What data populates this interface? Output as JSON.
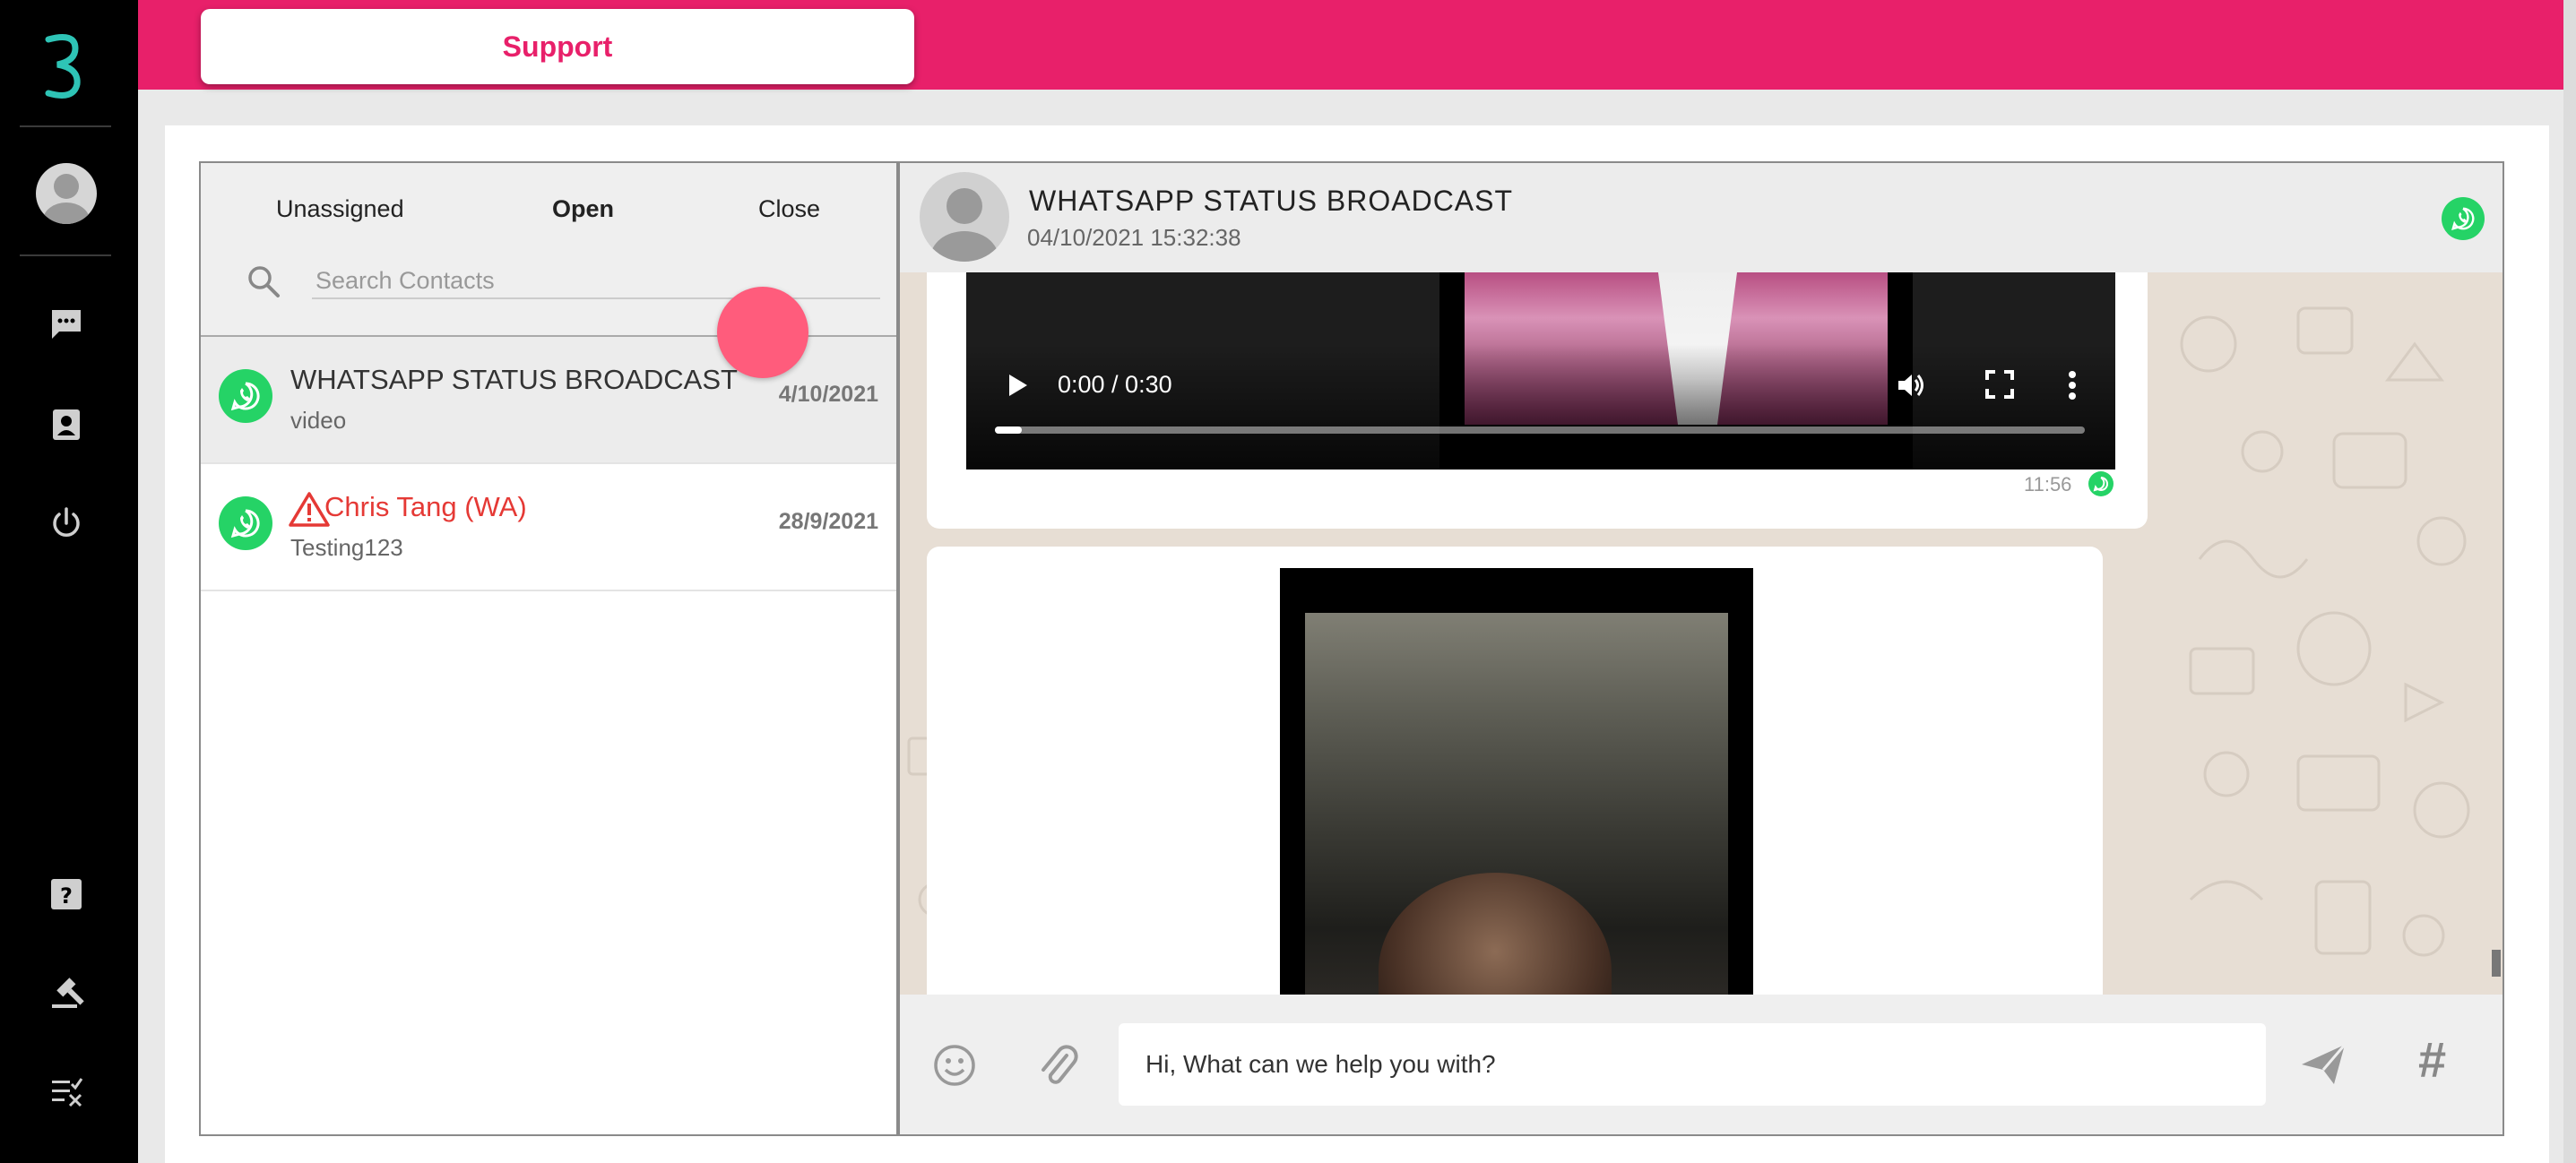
{
  "header": {
    "support_label": "Support"
  },
  "tabs": {
    "unassigned": "Unassigned",
    "open": "Open",
    "close": "Close"
  },
  "search": {
    "placeholder": "Search Contacts"
  },
  "contacts": [
    {
      "name": "WHATSAPP STATUS BROADCAST",
      "preview": "video",
      "date": "4/10/2021",
      "channel_icon": "whatsapp-icon"
    },
    {
      "name": "Chris Tang (WA)",
      "preview": "Testing123",
      "date": "28/9/2021",
      "channel_icon": "whatsapp-icon",
      "status_icon": "warning-icon"
    }
  ],
  "chat": {
    "title": "WHATSAPP STATUS BROADCAST",
    "timestamp": "04/10/2021 15:32:38",
    "messages": [
      {
        "type": "video",
        "time_display": "0:00 / 0:30",
        "sent_time": "11:56"
      },
      {
        "type": "video"
      }
    ]
  },
  "composer": {
    "placeholder": "Hi, What can we help you with?",
    "hashtag_label": "#"
  },
  "colors": {
    "brand": "#e8206a",
    "whatsapp": "#25d366",
    "warning": "#e53935",
    "fab": "#ff5c7c"
  }
}
